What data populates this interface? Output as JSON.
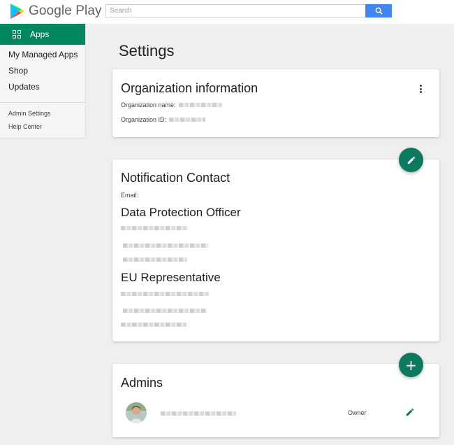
{
  "header": {
    "brand": "Google Play",
    "search_placeholder": "Search"
  },
  "sidebar": {
    "active": "Apps",
    "items": [
      "My Managed Apps",
      "Shop",
      "Updates"
    ],
    "footer_items": [
      "Admin Settings",
      "Help Center"
    ]
  },
  "page": {
    "title": "Settings"
  },
  "org_card": {
    "title": "Organization information",
    "name_label": "Organization name:",
    "id_label": "Organization ID:"
  },
  "notification_card": {
    "title": "Notification Contact",
    "email_label": "Email:",
    "dpo_title": "Data Protection Officer",
    "eu_title": "EU Representative"
  },
  "admins_card": {
    "title": "Admins",
    "rows": [
      {
        "role": "Owner"
      }
    ]
  },
  "colors": {
    "accent": "#01875f",
    "fab": "#0b7a61",
    "search_button": "#4285f4"
  },
  "icons": [
    "google-play-logo-icon",
    "search-icon",
    "apps-grid-icon",
    "more-vert-icon",
    "edit-icon",
    "add-icon",
    "avatar"
  ]
}
